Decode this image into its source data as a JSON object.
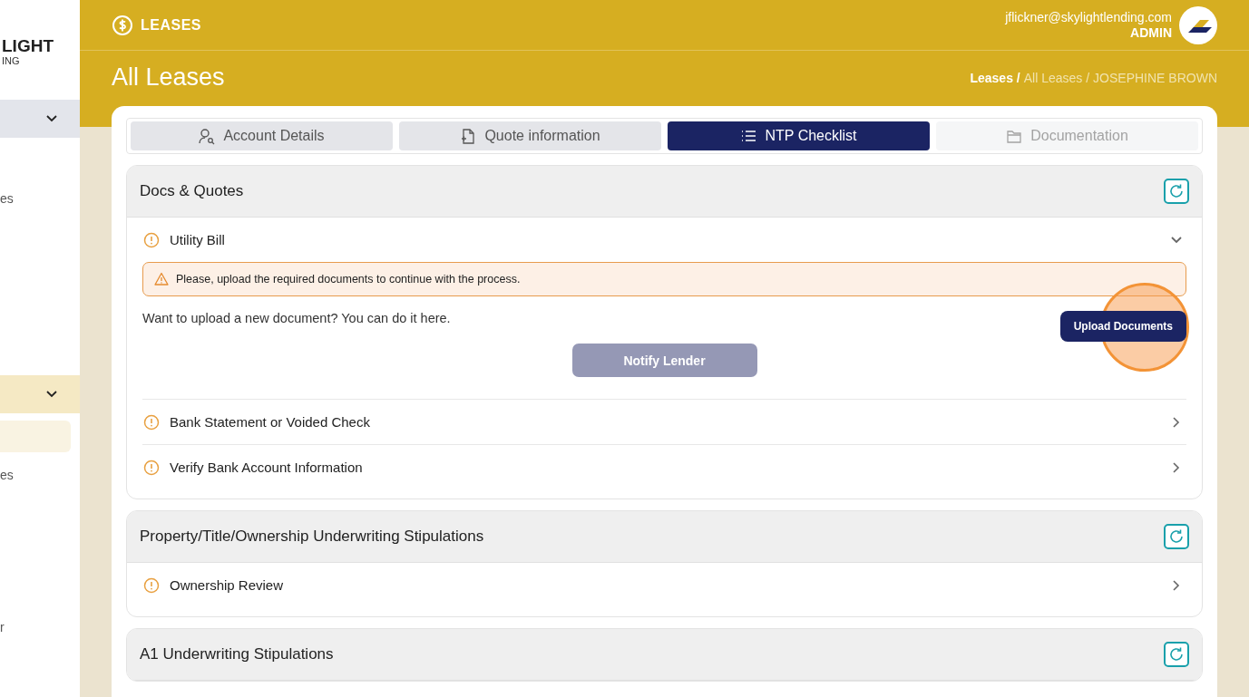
{
  "sidebar": {
    "logo": {
      "line1": "LIGHT",
      "line2": "ING"
    },
    "items": [
      {
        "kind": "group",
        "expanded": true,
        "selected": false
      },
      {
        "kind": "link",
        "label": "es",
        "selected": false
      },
      {
        "kind": "group",
        "expanded": true,
        "selected": true
      },
      {
        "kind": "link",
        "selected": true
      },
      {
        "kind": "link",
        "label": "es",
        "selected": false
      },
      {
        "kind": "link",
        "label": "r",
        "selected": false
      }
    ]
  },
  "topbar": {
    "module": "LEASES",
    "user_email": "jflickner@skylightlending.com",
    "user_role": "ADMIN"
  },
  "page": {
    "title": "All Leases",
    "breadcrumb": [
      {
        "label": "Leases /",
        "current": false
      },
      {
        "label": "All Leases /",
        "current": true
      },
      {
        "label": "JOSEPHINE BROWN",
        "current": true
      }
    ]
  },
  "tabs": [
    {
      "label": "Account Details",
      "selected": false,
      "disabled": false
    },
    {
      "label": "Quote information",
      "selected": false,
      "disabled": false
    },
    {
      "label": "NTP Checklist",
      "selected": true,
      "disabled": false
    },
    {
      "label": "Documentation",
      "selected": false,
      "disabled": true
    }
  ],
  "sections": [
    {
      "title": "Docs & Quotes",
      "items": [
        {
          "label": "Utility Bill",
          "expanded": true,
          "alert": "Please, upload the required documents to continue with the process.",
          "prompt": "Want to upload a new document? You can do it here.",
          "upload_button": {
            "label": "Upload Documents",
            "highlighted": true
          },
          "notify_button": {
            "label": "Notify Lender",
            "disabled": true
          }
        },
        {
          "label": "Bank Statement or Voided Check",
          "expanded": false
        },
        {
          "label": "Verify Bank Account Information",
          "expanded": false
        }
      ]
    },
    {
      "title": "Property/Title/Ownership Underwriting Stipulations",
      "items": [
        {
          "label": "Ownership Review",
          "expanded": false
        }
      ]
    },
    {
      "title": "A1 Underwriting Stipulations"
    }
  ]
}
